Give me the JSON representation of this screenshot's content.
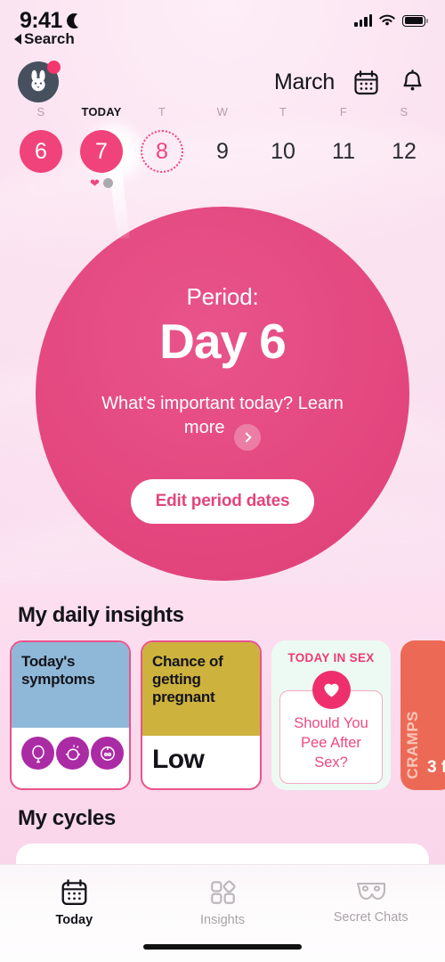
{
  "status_bar": {
    "time": "9:41",
    "moon_icon": "moon-icon",
    "signal_icon": "cellular-signal-icon",
    "wifi_icon": "wifi-icon",
    "battery_icon": "battery-full-icon"
  },
  "back_link": {
    "label": "Search",
    "icon": "back-triangle-icon"
  },
  "header": {
    "avatar_icon": "rabbit-avatar-icon",
    "avatar_badge": "notification-dot",
    "month": "March",
    "calendar_icon": "calendar-icon",
    "bell_icon": "bell-icon"
  },
  "week_strip": {
    "weekday_labels": [
      "S",
      "TODAY",
      "T",
      "W",
      "T",
      "F",
      "S"
    ],
    "today_index": 1,
    "days": [
      {
        "num": "6",
        "state": "period"
      },
      {
        "num": "7",
        "state": "today-period",
        "marks": [
          "heart",
          "dot"
        ]
      },
      {
        "num": "8",
        "state": "predicted"
      },
      {
        "num": "9",
        "state": "normal"
      },
      {
        "num": "10",
        "state": "normal"
      },
      {
        "num": "11",
        "state": "normal"
      },
      {
        "num": "12",
        "state": "normal"
      }
    ]
  },
  "main_circle": {
    "label": "Period:",
    "day": "Day 6",
    "learn_more": "What's important today? Learn more",
    "chevron_icon": "chevron-right-icon",
    "edit_button": "Edit period dates",
    "color": "#e4497e"
  },
  "insights": {
    "title": "My daily insights",
    "cards": [
      {
        "name": "todays-symptoms",
        "head": "Today's symptoms",
        "head_color": "#8fb8d8",
        "icons": [
          "symptom-cramps-icon",
          "symptom-bloating-icon",
          "symptom-flow-icon"
        ]
      },
      {
        "name": "chance-of-getting-pregnant",
        "head": "Chance of getting pregnant",
        "head_color": "#cdb23e",
        "value": "Low"
      },
      {
        "name": "today-in-sex",
        "title": "TODAY IN SEX",
        "heart_icon": "heart-icon",
        "article": "Should You Pee After Sex?"
      },
      {
        "name": "cramps",
        "vertical_label": "CRAMPS",
        "partial_text": "3\nf",
        "color": "#ec6a55"
      }
    ]
  },
  "cycles": {
    "title": "My cycles"
  },
  "tabbar": {
    "tabs": [
      {
        "label": "Today",
        "icon": "calendar-icon",
        "active": true
      },
      {
        "label": "Insights",
        "icon": "shapes-icon",
        "active": false
      },
      {
        "label": "Secret Chats",
        "icon": "mask-icon",
        "active": false
      }
    ]
  }
}
